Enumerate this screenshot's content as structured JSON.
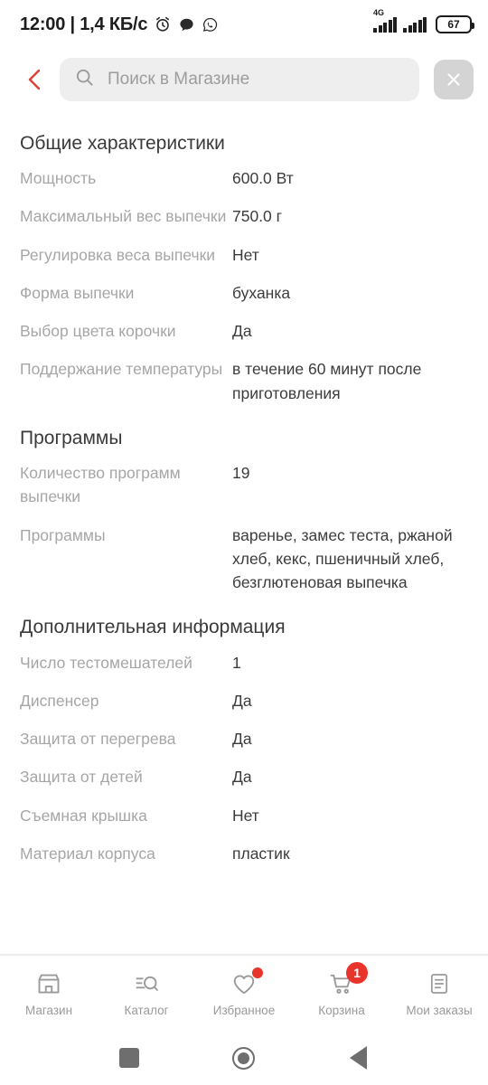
{
  "statusbar": {
    "clock": "12:00 | 1,4 КБ/с",
    "network_type": "4G",
    "battery_level": "67",
    "icons": [
      "alarm-clock-icon",
      "message-bubble-icon",
      "whatsapp-icon"
    ]
  },
  "header": {
    "back_label": "",
    "search_placeholder": "Поиск в Магазине",
    "search_value": "",
    "close_label": "",
    "accent_color": "#d9483e"
  },
  "specs": {
    "sections": [
      {
        "title": "Общие характеристики",
        "rows": [
          {
            "label": "Мощность",
            "value": "600.0 Вт"
          },
          {
            "label": "Максимальный вес выпечки",
            "value": "750.0 г"
          },
          {
            "label": "Регулировка веса выпечки",
            "value": "Нет"
          },
          {
            "label": "Форма выпечки",
            "value": "буханка"
          },
          {
            "label": "Выбор цвета корочки",
            "value": "Да"
          },
          {
            "label": "Поддержание температуры",
            "value": "в течение 60 минут после приготовления"
          }
        ]
      },
      {
        "title": "Программы",
        "rows": [
          {
            "label": "Количество программ выпечки",
            "value": "19"
          },
          {
            "label": "Программы",
            "value": "варенье, замес теста, ржаной хлеб, кекс, пшеничный хлеб, безглютеновая выпечка"
          }
        ]
      },
      {
        "title": "Дополнительная информация",
        "rows": [
          {
            "label": "Число тестомешателей",
            "value": "1"
          },
          {
            "label": "Диспенсер",
            "value": "Да"
          },
          {
            "label": "Защита от перегрева",
            "value": "Да"
          },
          {
            "label": "Защита от детей",
            "value": "Да"
          },
          {
            "label": "Съемная крышка",
            "value": "Нет"
          },
          {
            "label": "Материал корпуса",
            "value": "пластик"
          }
        ]
      }
    ]
  },
  "bottom_nav": {
    "badge_color": "#e8342a",
    "items": [
      {
        "label": "Магазин",
        "icon": "store-icon",
        "badge": "",
        "dot": false
      },
      {
        "label": "Каталог",
        "icon": "catalog-search-icon",
        "badge": "",
        "dot": false
      },
      {
        "label": "Избранное",
        "icon": "heart-icon",
        "badge": "",
        "dot": true
      },
      {
        "label": "Корзина",
        "icon": "cart-icon",
        "badge": "1",
        "dot": false
      },
      {
        "label": "Мои заказы",
        "icon": "document-list-icon",
        "badge": "",
        "dot": false
      }
    ]
  },
  "android_nav": {
    "recents": "recents-square-icon",
    "home": "home-circle-icon",
    "back": "back-triangle-icon"
  }
}
